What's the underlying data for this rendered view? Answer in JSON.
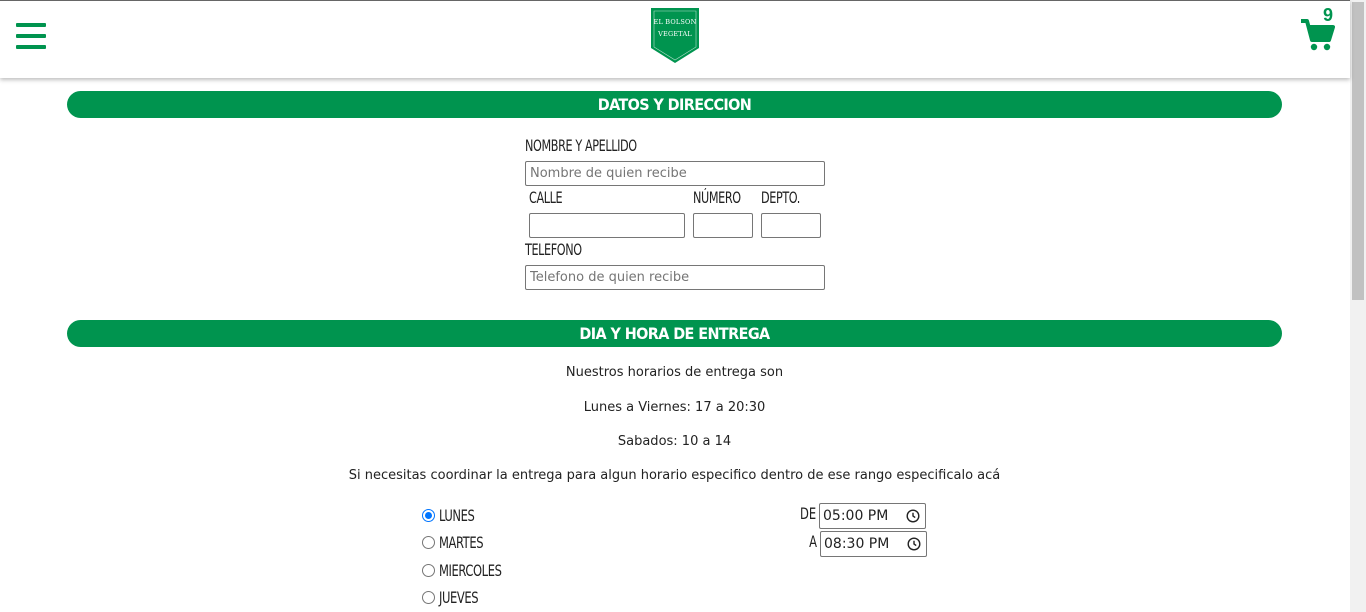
{
  "header": {
    "logo_line1": "EL BOLSON",
    "logo_line2": "VEGETAL",
    "cart_count": "9",
    "icons": {
      "menu": "hamburger-icon",
      "cart": "shopping-cart-icon"
    },
    "brand_color": "#00944f"
  },
  "section1": {
    "title": "DATOS Y DIRECCION",
    "name_label": "NOMBRE Y APELLIDO",
    "name_placeholder": "Nombre de quien recibe",
    "street_label": "CALLE",
    "number_label": "NÚMERO",
    "apt_label": "DEPTO.",
    "phone_label": "TELEFONO",
    "phone_placeholder": "Telefono de quien recibe"
  },
  "section2": {
    "title": "DIA Y HORA DE ENTREGA",
    "line1": "Nuestros horarios de entrega son",
    "line2": "Lunes a Viernes: 17 a 20:30",
    "line3": "Sabados: 10 a 14",
    "line4": "Si necesitas coordinar la entrega para algun horario especifico dentro de ese rango especificalo acá",
    "days": [
      {
        "label": "LUNES",
        "checked": true
      },
      {
        "label": "MARTES",
        "checked": false
      },
      {
        "label": "MIERCOLES",
        "checked": false
      },
      {
        "label": "JUEVES",
        "checked": false
      }
    ],
    "from_label": "DE",
    "from_value": "05:00 PM",
    "to_label": "A",
    "to_value": "08:30 PM",
    "radio_color": "#0075ff"
  }
}
